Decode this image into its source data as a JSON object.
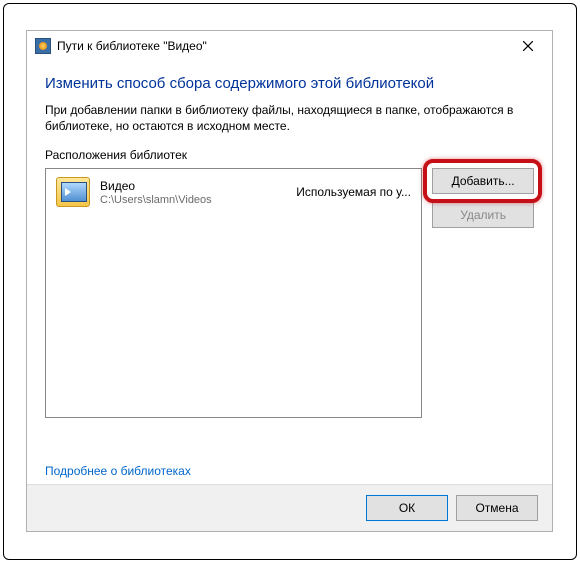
{
  "window": {
    "title": "Пути к библиотеке \"Видео\""
  },
  "content": {
    "heading": "Изменить способ сбора содержимого этой библиотекой",
    "description": "При добавлении папки в библиотеку файлы, находящиеся в папке, отображаются в библиотеке, но остаются в исходном месте.",
    "section_label": "Расположения библиотек"
  },
  "list": {
    "items": [
      {
        "name": "Видео",
        "path": "C:\\Users\\slamn\\Videos",
        "status": "Используемая по у..."
      }
    ]
  },
  "buttons": {
    "add": "Добавить...",
    "remove": "Удалить",
    "ok": "ОК",
    "cancel": "Отмена"
  },
  "link": {
    "learn_more": "Подробнее о библиотеках"
  }
}
